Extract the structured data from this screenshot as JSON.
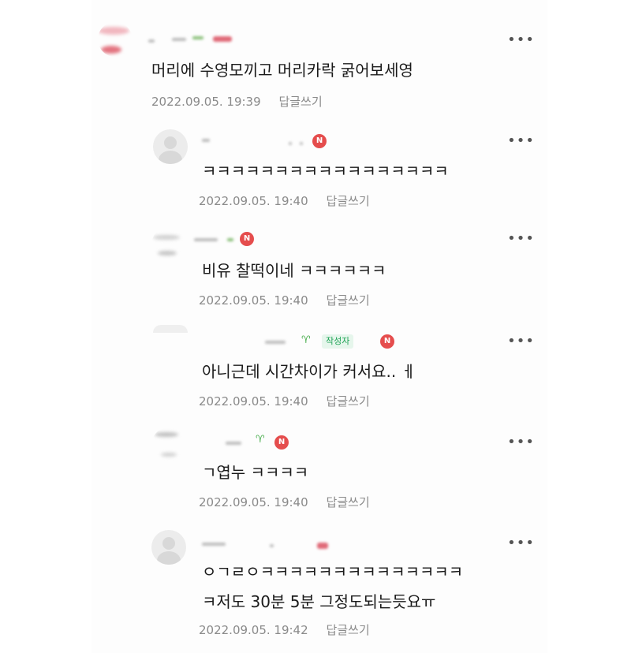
{
  "comments": [
    {
      "text": "머리에 수영모끼고 머리카락 굵어보세영",
      "date": "2022.09.05. 19:39",
      "reply_label": "답글쓰기",
      "more_icon": "more-dots-icon"
    },
    {
      "badge": "N",
      "text": "ㅋㅋㅋㅋㅋㅋㅋㅋㅋㅋㅋㅋㅋㅋㅋㅋㅋ",
      "date": "2022.09.05. 19:40",
      "reply_label": "답글쓰기"
    },
    {
      "badge": "N",
      "text": "비유 찰떡이네 ㅋㅋㅋㅋㅋㅋ",
      "date": "2022.09.05. 19:40",
      "reply_label": "답글쓰기"
    },
    {
      "author_tag": "작성자",
      "badge": "N",
      "text": "아니근데 시간차이가 커서요.. ㅔ",
      "date": "2022.09.05. 19:40",
      "reply_label": "답글쓰기"
    },
    {
      "badge": "N",
      "text": "ㄱ엽누 ㅋㅋㅋㅋ",
      "date": "2022.09.05. 19:40",
      "reply_label": "답글쓰기"
    },
    {
      "text_line1": "ㅇㄱㄹㅇㅋㅋㅋㅋㅋㅋㅋㅋㅋㅋㅋㅋㅋㅋ",
      "text_line2": "ㅋ저도 30분 5분 그정도되는듯요ㅠ",
      "date": "2022.09.05. 19:42",
      "reply_label": "답글쓰기"
    }
  ],
  "more_glyph": "•••",
  "colors": {
    "new_badge": "#e54d4d",
    "author_tag": "#1fa356",
    "meta_text": "#8a8a8a"
  }
}
